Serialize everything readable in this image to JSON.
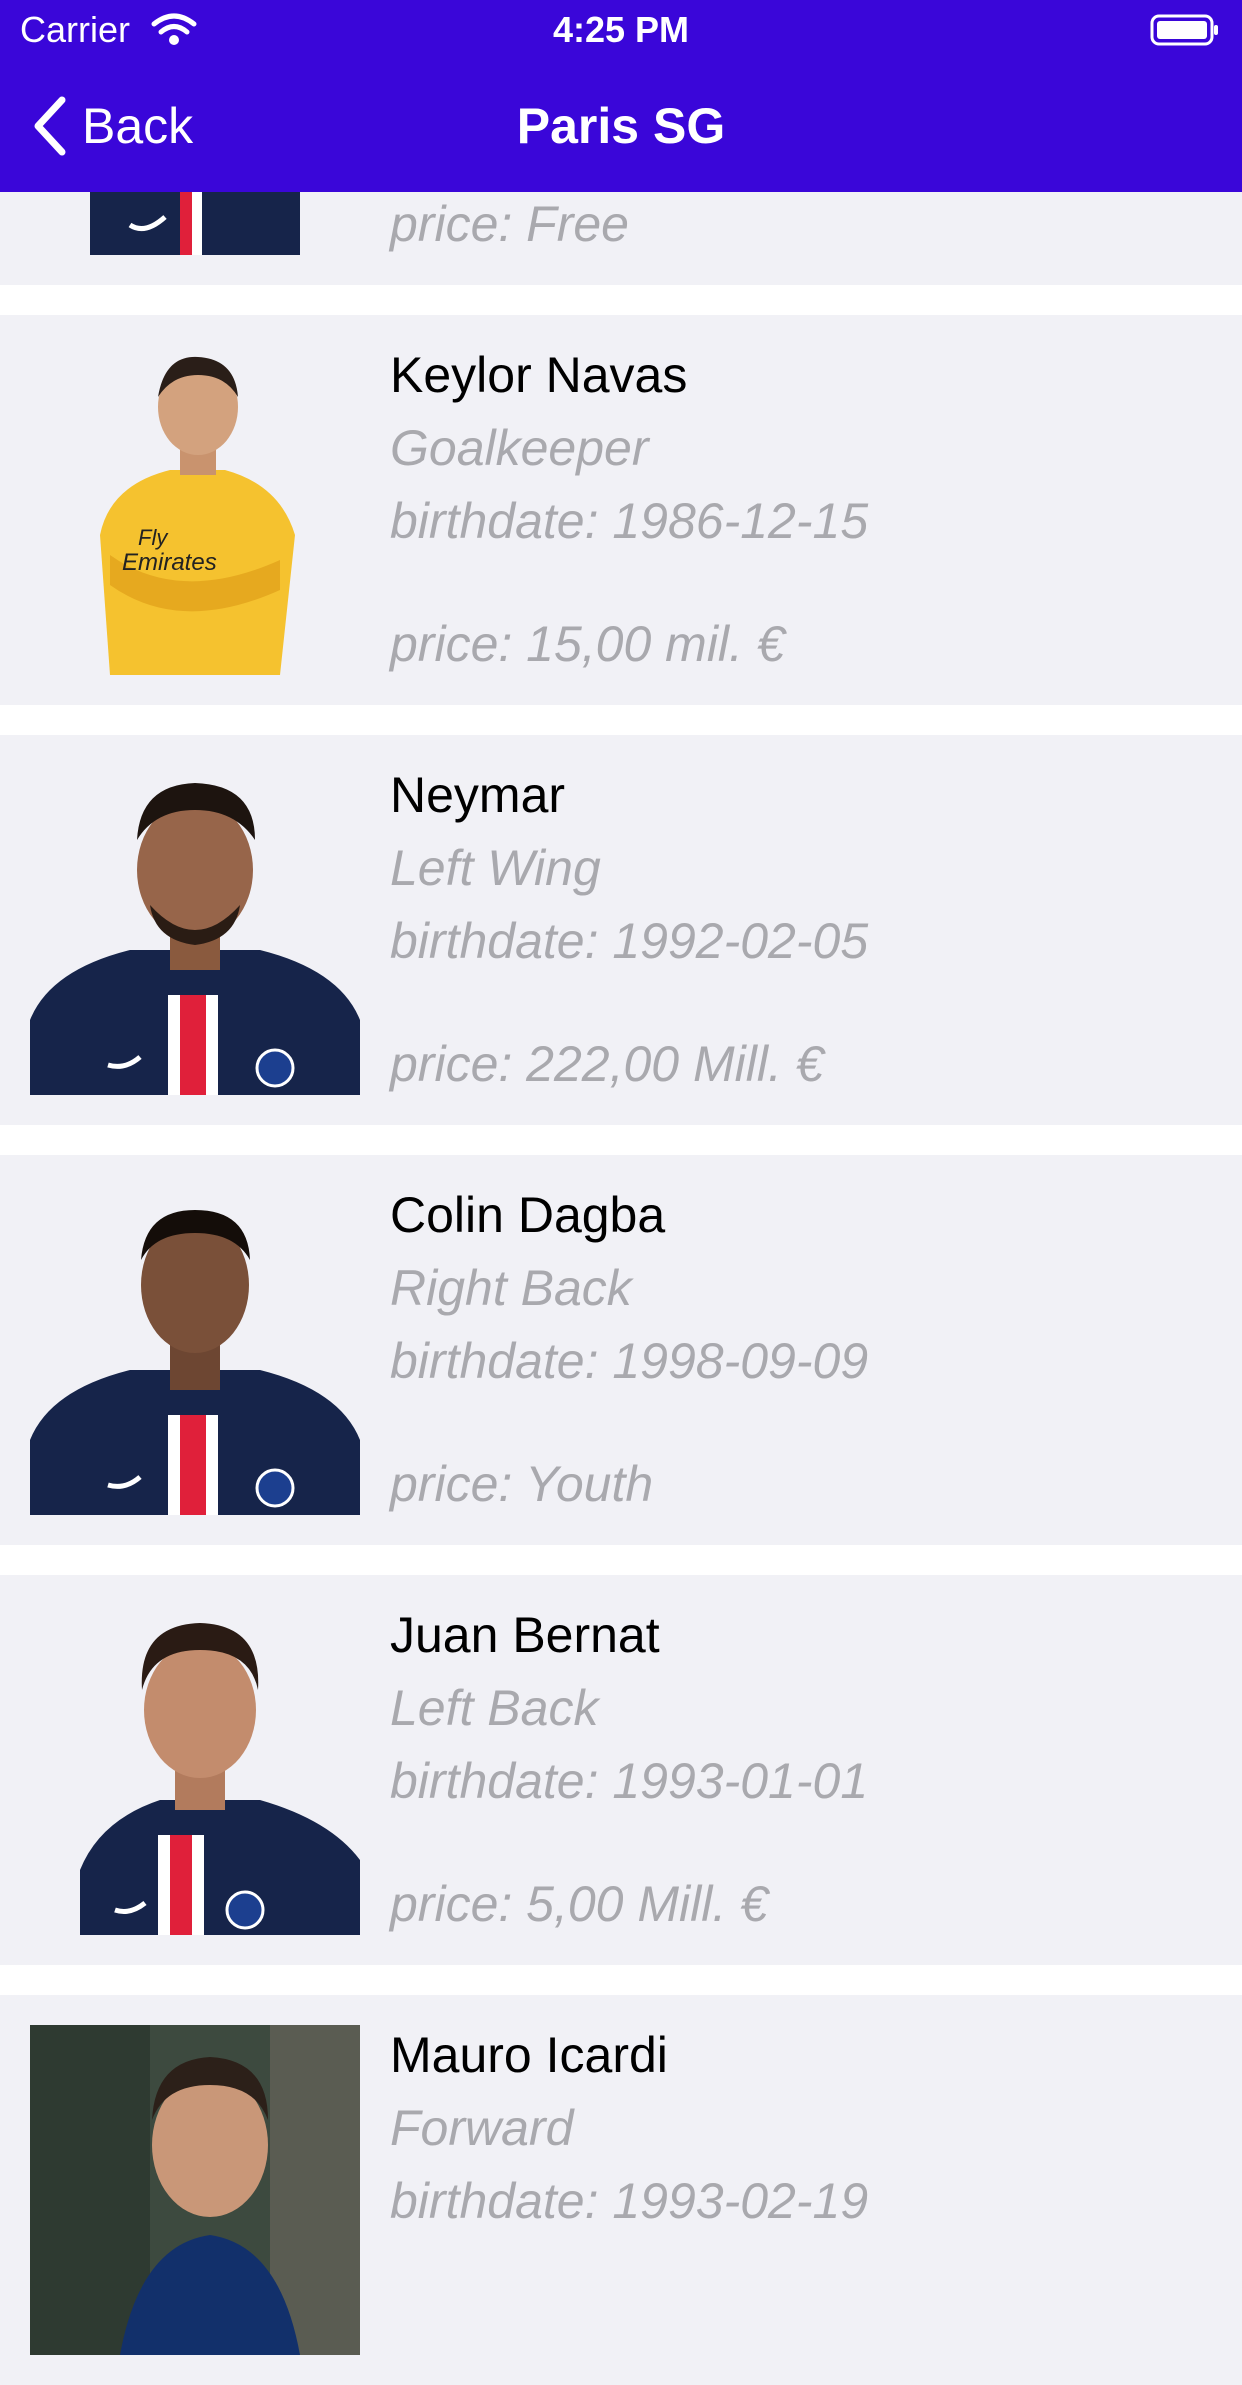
{
  "status_bar": {
    "carrier": "Carrier",
    "time": "4:25 PM"
  },
  "nav": {
    "back_label": "Back",
    "title": "Paris SG"
  },
  "colors": {
    "accent": "#3a06d9",
    "row_background": "#f1f1f6",
    "secondary_text": "#a9a9ae"
  },
  "players": [
    {
      "price": "price: Free",
      "kit": "psg"
    },
    {
      "name": "Keylor Navas",
      "position": "Goalkeeper",
      "birthdate": "birthdate: 1986-12-15",
      "price": "price: 15,00 mil. €",
      "kit": "yellow"
    },
    {
      "name": "Neymar",
      "position": "Left Wing",
      "birthdate": "birthdate: 1992-02-05",
      "price": "price: 222,00 Mill. €",
      "kit": "psg"
    },
    {
      "name": "Colin Dagba",
      "position": "Right Back",
      "birthdate": "birthdate: 1998-09-09",
      "price": "price: Youth",
      "kit": "psg"
    },
    {
      "name": "Juan Bernat",
      "position": "Left Back",
      "birthdate": "birthdate: 1993-01-01",
      "price": "price: 5,00 Mill. €",
      "kit": "psg"
    },
    {
      "name": "Mauro Icardi",
      "position": "Forward",
      "birthdate": "birthdate: 1993-02-19",
      "kit": "inter"
    }
  ]
}
